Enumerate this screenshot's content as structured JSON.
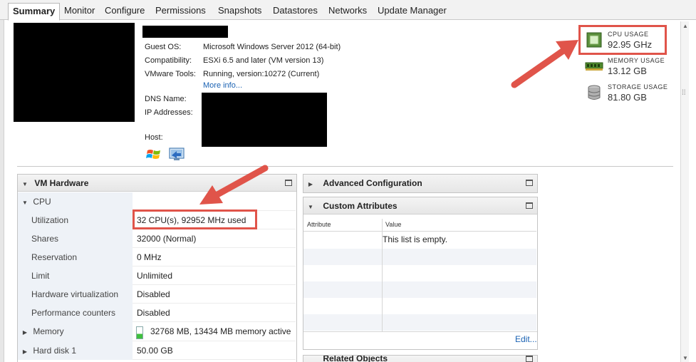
{
  "tabs": [
    {
      "label": "Summary",
      "active": true
    },
    {
      "label": "Monitor"
    },
    {
      "label": "Configure"
    },
    {
      "label": "Permissions"
    },
    {
      "label": "Snapshots"
    },
    {
      "label": "Datastores"
    },
    {
      "label": "Networks"
    },
    {
      "label": "Update Manager"
    }
  ],
  "summary": {
    "guest_os_label": "Guest OS:",
    "guest_os_value": "Microsoft Windows Server 2012 (64-bit)",
    "compat_label": "Compatibility:",
    "compat_value": "ESXi 6.5 and later (VM version 13)",
    "tools_label": "VMware Tools:",
    "tools_value": "Running, version:10272 (Current)",
    "more_info": "More info...",
    "dns_label": "DNS Name:",
    "ip_label": "IP Addresses:",
    "host_label": "Host:"
  },
  "usage": {
    "cpu_label": "CPU USAGE",
    "cpu_value": "92.95 GHz",
    "mem_label": "MEMORY USAGE",
    "mem_value": "13.12 GB",
    "storage_label": "STORAGE USAGE",
    "storage_value": "81.80 GB"
  },
  "vm_hardware": {
    "title": "VM Hardware",
    "cpu_section": "CPU",
    "rows": [
      {
        "label": "Utilization",
        "value": "32 CPU(s), 92952 MHz used"
      },
      {
        "label": "Shares",
        "value": "32000 (Normal)"
      },
      {
        "label": "Reservation",
        "value": "0 MHz"
      },
      {
        "label": "Limit",
        "value": "Unlimited"
      },
      {
        "label": "Hardware virtualization",
        "value": "Disabled"
      },
      {
        "label": "Performance counters",
        "value": "Disabled"
      }
    ],
    "memory_label": "Memory",
    "memory_value": "32768 MB, 13434 MB memory active",
    "memory_active_fraction": 0.41,
    "disk_label": "Hard disk 1",
    "disk_value": "50.00 GB"
  },
  "advanced_config": {
    "title": "Advanced Configuration"
  },
  "custom_attributes": {
    "title": "Custom Attributes",
    "col_attribute": "Attribute",
    "col_value": "Value",
    "empty_text": "This list is empty.",
    "edit_link": "Edit..."
  },
  "related_objects": {
    "title": "Related Objects"
  },
  "colors": {
    "highlight": "#e0544a",
    "link": "#1a62b3"
  }
}
